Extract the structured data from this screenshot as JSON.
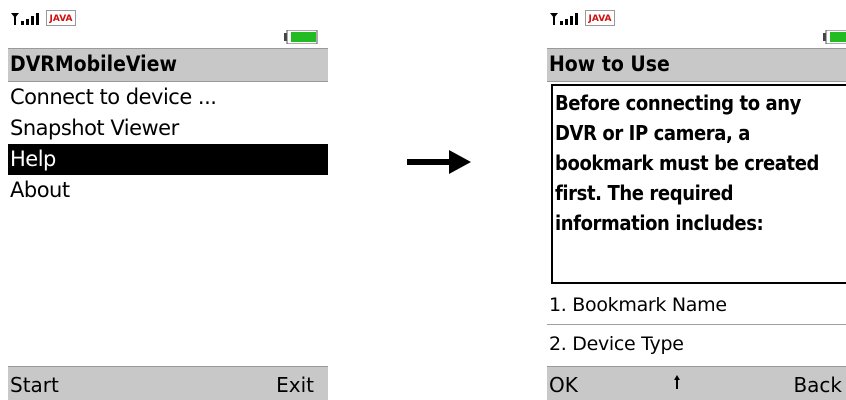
{
  "left_screen": {
    "status": {
      "java_badge": "JAVA"
    },
    "title": "DVRMobileView",
    "menu_items": [
      {
        "label": "Connect to device ...",
        "selected": false
      },
      {
        "label": "Snapshot Viewer",
        "selected": false
      },
      {
        "label": "Help",
        "selected": true
      },
      {
        "label": "About",
        "selected": false
      }
    ],
    "softkeys": {
      "left": "Start",
      "right": "Exit"
    }
  },
  "right_screen": {
    "status": {
      "java_badge": "JAVA"
    },
    "title": "How to Use",
    "help_text": "Before connecting to any DVR or IP camera, a bookmark must be created first. The required information includes:",
    "list_items": [
      "1. Bookmark Name",
      "2. Device Type"
    ],
    "softkeys": {
      "left": "OK",
      "right": "Back"
    }
  },
  "colors": {
    "bar_gray": "#c8c8c8",
    "selection": "#000000",
    "battery_green": "#22bb22",
    "java_red": "#d01010"
  },
  "icons": [
    "signal-icon",
    "java-badge",
    "battery-icon",
    "arrow-right-icon",
    "scroll-indicator-icon"
  ]
}
